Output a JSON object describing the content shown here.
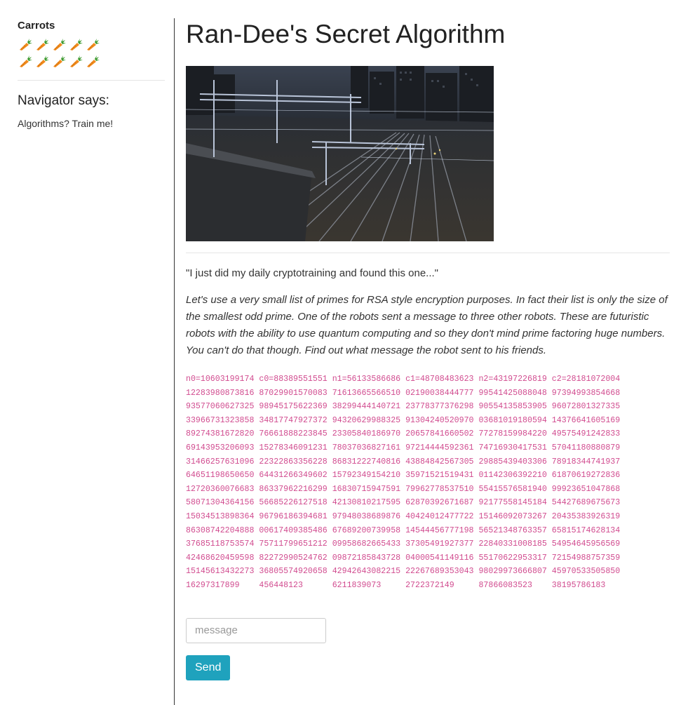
{
  "sidebar": {
    "carrots_title": "Carrots",
    "carrot_count": 10,
    "carrot_icon": "carrot-icon",
    "navigator_title": "Navigator says:",
    "navigator_text": "Algorithms? Train me!"
  },
  "main": {
    "title": "Ran-Dee's Secret Algorithm",
    "image_description": "night-time railway yard with overhead gantries",
    "quote": "\"I just did my daily cryptotraining and found this one...\"",
    "story": "Let's use a very small list of primes for RSA style encryption purposes. In fact their list is only the size of the smallest odd prime. One of the robots sent a message to three other robots. These are futuristic robots with the ability to use quantum computing and so they don't mind prime factoring huge numbers. You can't do that though. Find out what message the robot sent to his friends.",
    "cipher_lines": [
      "n0=10603199174 c0=88389551551 n1=56133586686 c1=48708483623 n2=43197226819 c2=28181072004",
      "12283980873816 87029901570083 71613665566510 02190038444777 99541425088048 97394993854668",
      "93577060627325 98945175622369 38299444140721 23778377376298 90554135853905 96072801327335",
      "33966731323858 34817747927372 94320629988325 91304240520970 03681019180594 14376641605169",
      "89274381672820 76661888223845 23305840186970 20657841660502 77278159984220 49575491242833",
      "69143953206093 15278346091231 78037036827161 97214444592361 74716930417531 57041180880879",
      "31466257631096 22322863356228 86831222740816 43884842567305 29885439403306 78918344741937",
      "64651198650650 64431266349602 15792349154210 35971521519431 01142306392210 61870619272836",
      "12720360076683 86337962216299 16830715947591 79962778537510 55415576581940 99923651047868",
      "58071304364156 56685226127518 42130810217595 62870392671687 92177558145184 54427689675673",
      "15034513898364 96796186394681 97948038689876 40424012477722 15146092073267 20435383926319",
      "86308742204888 00617409385486 67689200739958 14544456777198 56521348763357 65815174628134",
      "37685118753574 75711799651212 09958682665433 37305491927377 22840331008185 54954645956569",
      "42468620459598 82272990524762 09872185843728 04000541149116 55170622953317 72154988757359",
      "15145613432273 36805574920658 42942643082215 22267689353043 98029973666807 45970533505850",
      "16297317899    456448123      6211839073     2722372149     87866083523    38195786183"
    ],
    "input_placeholder": "message",
    "input_value": "",
    "send_label": "Send"
  },
  "colors": {
    "accent": "#1fa2bd",
    "cipher_text": "#d14b8f",
    "divider": "#e5e5e5"
  }
}
